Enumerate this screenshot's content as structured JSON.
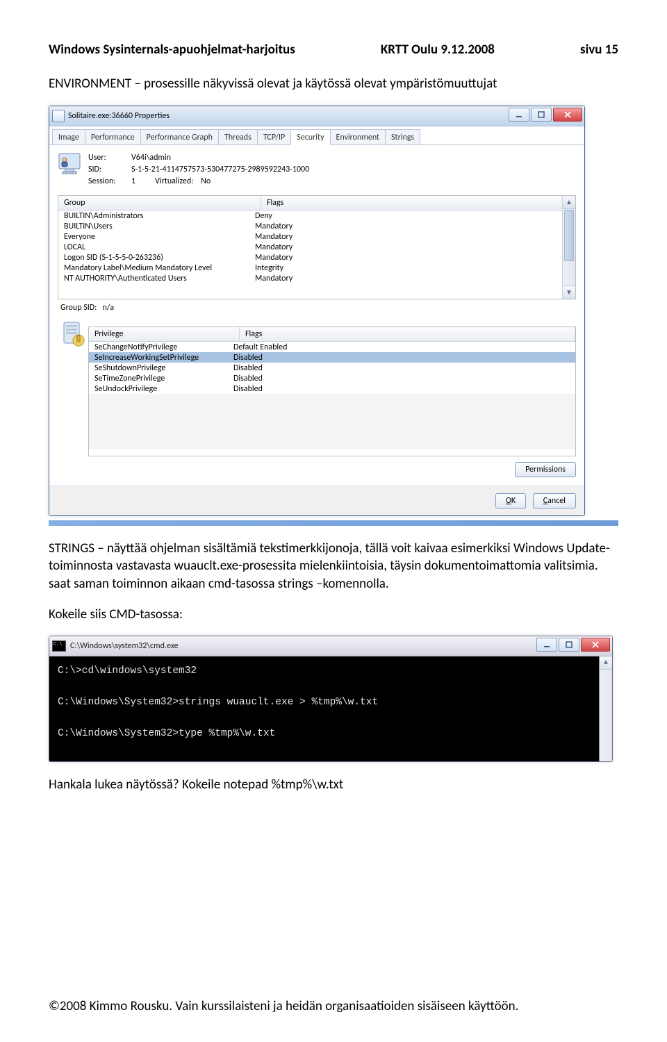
{
  "header": {
    "left": "Windows Sysinternals-apuohjelmat-harjoitus",
    "center": "KRTT Oulu 9.12.2008",
    "right": "sivu 15"
  },
  "para1": "ENVIRONMENT – prosessille näkyvissä olevat ja käytössä olevat ympäristömuuttujat",
  "para2a": "STRINGS – näyttää ohjelman sisältämiä tekstimerkkijonoja, tällä voit kaivaa esimerkiksi Windows Update-toiminnosta vastavasta wuauclt.exe-prosessita mielenkiintoisia, täysin dokumentoimattomia valitsimia.",
  "para2b": "saat saman toiminnon aikaan cmd-tasossa strings –komennolla.",
  "para3": "Kokeile siis CMD-tasossa:",
  "para4": "Hankala lukea näytössä? Kokeile notepad %tmp%\\w.txt",
  "footer": "©2008 Kimmo Rousku. Vain kurssilaisteni ja heidän organisaatioiden sisäiseen käyttöön.",
  "dialog": {
    "title": "Solitaire.exe:36660 Properties",
    "tabs": [
      "Image",
      "Performance",
      "Performance Graph",
      "Threads",
      "TCP/IP",
      "Security",
      "Environment",
      "Strings"
    ],
    "active_tab_index": 5,
    "user": {
      "user_label": "User:",
      "user_value": "V64i\\admin",
      "sid_label": "SID:",
      "sid_value": "S-1-5-21-4114757573-530477275-2989592243-1000",
      "session_label": "Session:",
      "session_value": "1",
      "virt_label": "Virtualized:",
      "virt_value": "No"
    },
    "groups": {
      "head_group": "Group",
      "head_flags": "Flags",
      "rows": [
        {
          "g": "BUILTIN\\Administrators",
          "f": "Deny"
        },
        {
          "g": "BUILTIN\\Users",
          "f": "Mandatory"
        },
        {
          "g": "Everyone",
          "f": "Mandatory"
        },
        {
          "g": "LOCAL",
          "f": "Mandatory"
        },
        {
          "g": "Logon SID (S-1-5-5-0-263236)",
          "f": "Mandatory"
        },
        {
          "g": "Mandatory Label\\Medium Mandatory Level",
          "f": "Integrity"
        },
        {
          "g": "NT AUTHORITY\\Authenticated Users",
          "f": "Mandatory"
        }
      ],
      "group_sid_label": "Group SID:",
      "group_sid_value": "n/a"
    },
    "privs": {
      "head_priv": "Privilege",
      "head_flags": "Flags",
      "rows": [
        {
          "p": "SeChangeNotifyPrivilege",
          "f": "Default Enabled",
          "sel": false
        },
        {
          "p": "SeIncreaseWorkingSetPrivilege",
          "f": "Disabled",
          "sel": true
        },
        {
          "p": "SeShutdownPrivilege",
          "f": "Disabled",
          "sel": false
        },
        {
          "p": "SeTimeZonePrivilege",
          "f": "Disabled",
          "sel": false
        },
        {
          "p": "SeUndockPrivilege",
          "f": "Disabled",
          "sel": false
        }
      ]
    },
    "perm_btn": "Permissions",
    "ok_btn": "OK",
    "cancel_btn": "Cancel"
  },
  "cmd": {
    "title": "C:\\Windows\\system32\\cmd.exe",
    "lines": [
      "C:\\>cd\\windows\\system32",
      "",
      "C:\\Windows\\System32>strings wuauclt.exe > %tmp%\\w.txt",
      "",
      "C:\\Windows\\System32>type %tmp%\\w.txt"
    ]
  }
}
